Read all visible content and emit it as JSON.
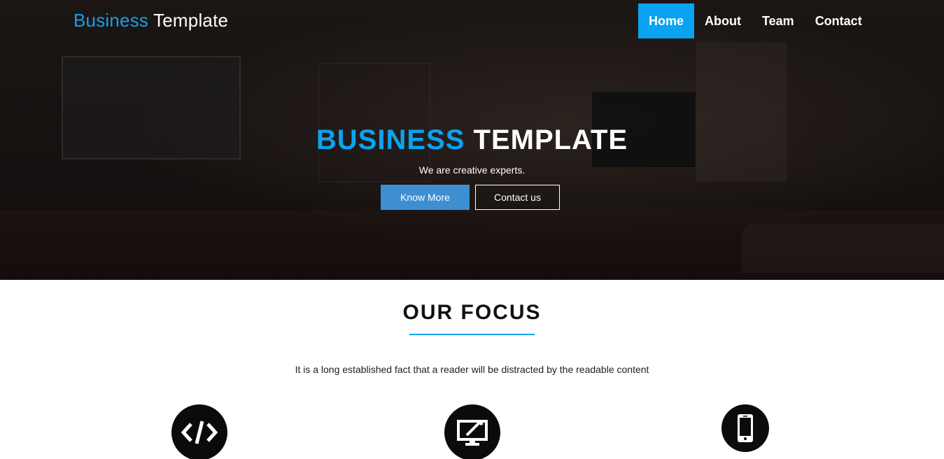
{
  "brand": {
    "part1": "Business",
    "part2": " Template"
  },
  "nav": {
    "items": [
      {
        "label": "Home",
        "active": true
      },
      {
        "label": "About",
        "active": false
      },
      {
        "label": "Team",
        "active": false
      },
      {
        "label": "Contact",
        "active": false
      }
    ]
  },
  "hero": {
    "title_part1": "BUSINESS",
    "title_part2": " TEMPLATE",
    "subtitle": "We are creative experts.",
    "primary_button": "Know More",
    "secondary_button": "Contact us"
  },
  "focus": {
    "title": "OUR FOCUS",
    "text": "It is a long established fact that a reader will be distracted by the readable content",
    "icons": [
      "code-icon",
      "monitor-pen-icon",
      "smartphone-icon"
    ]
  },
  "colors": {
    "accent": "#0aa3f2",
    "button_primary": "#3d8fd1",
    "hero_bg": "#161110",
    "icon_circle": "#0b0b0b"
  }
}
